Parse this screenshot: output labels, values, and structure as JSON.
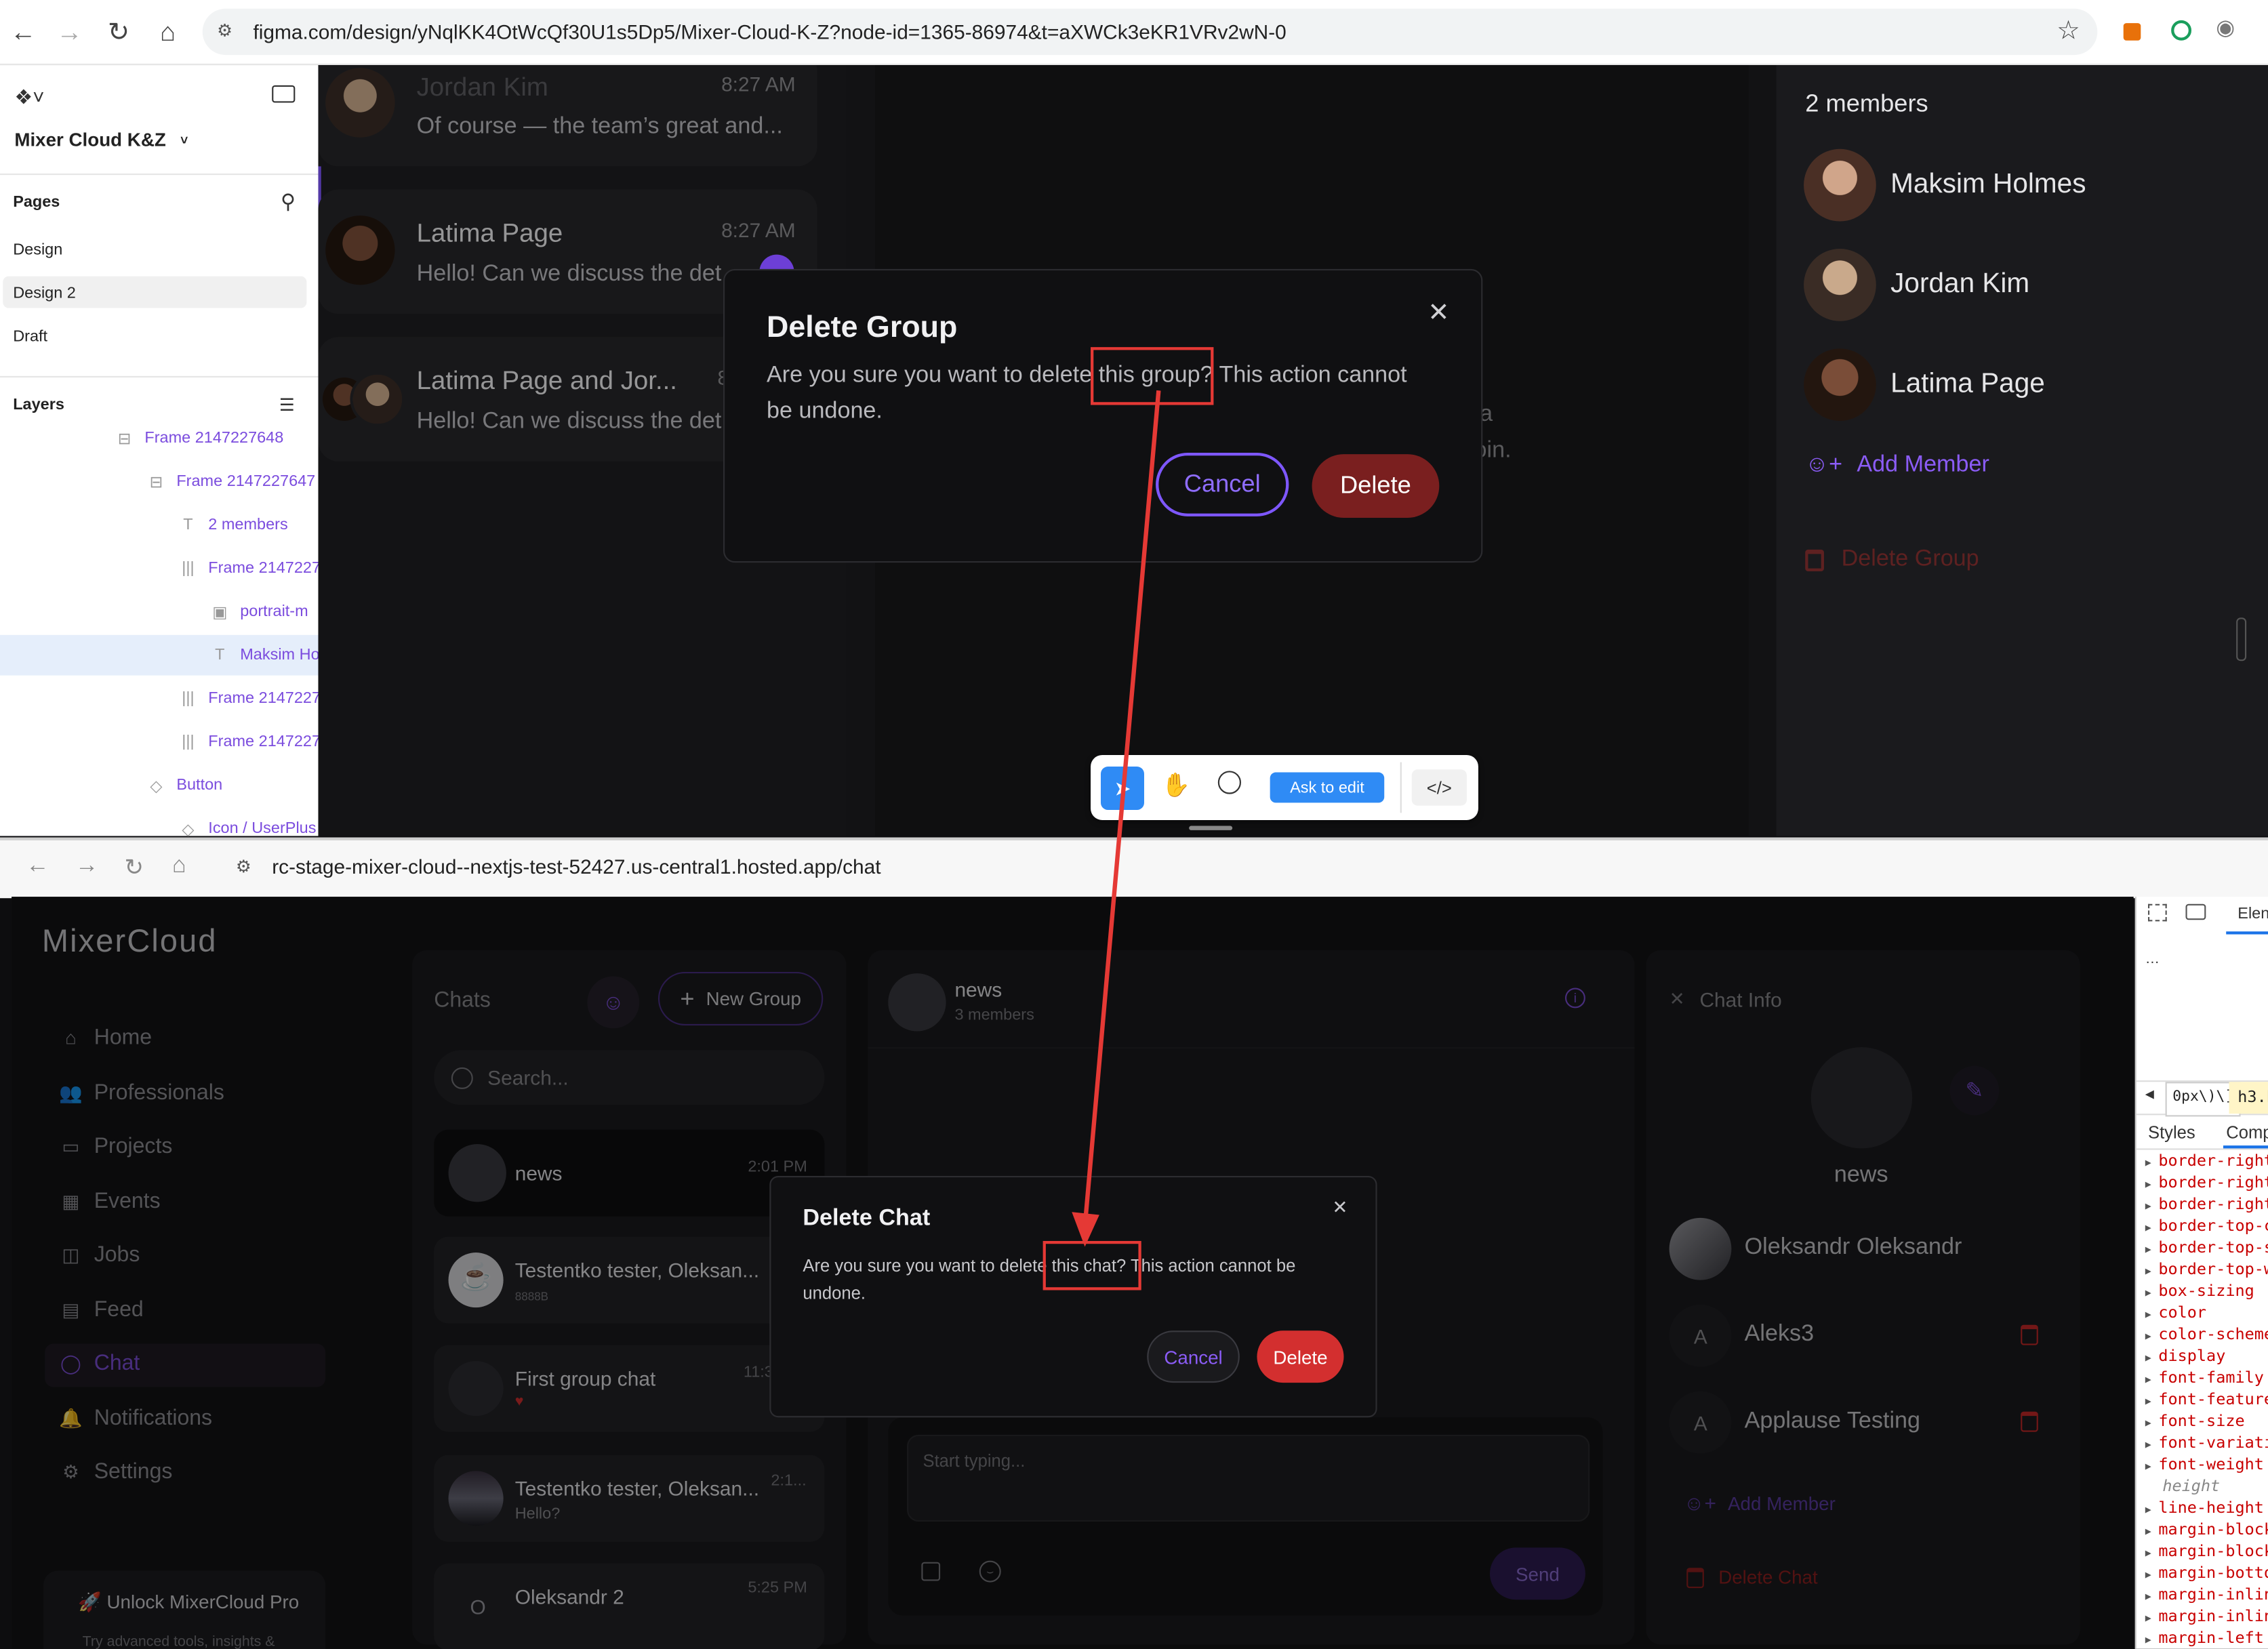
{
  "figma_browser": {
    "url": "figma.com/design/yNqlKK4OtWcQf30U1s5Dp5/Mixer-Cloud-K-Z?node-id=1365-86974&t=aXWCk3eKR1VRv2wN-0"
  },
  "figma_left": {
    "file_name": "Mixer Cloud K&Z",
    "pages_title": "Pages",
    "pages": [
      "Design",
      "Design 2",
      "Draft"
    ],
    "selected_page": "Design 2",
    "layers_title": "Layers",
    "layers": [
      {
        "label": "Frame 2147227648",
        "glyph": "⊟"
      },
      {
        "label": "Frame 2147227647",
        "glyph": "⊟"
      },
      {
        "label": "2 members",
        "glyph": "T"
      },
      {
        "label": "Frame 2147227",
        "glyph": "|||"
      },
      {
        "label": "portrait-m",
        "glyph": "▣"
      },
      {
        "label": "Maksim Ho",
        "glyph": "T"
      },
      {
        "label": "Frame 2147227",
        "glyph": "|||"
      },
      {
        "label": "Frame 2147227",
        "glyph": "|||"
      },
      {
        "label": "Button",
        "glyph": "◇"
      },
      {
        "label": "Icon / UserPlus",
        "glyph": "◇"
      }
    ]
  },
  "figma_canvas": {
    "chats": [
      {
        "name": "Jordan Kim",
        "time": "8:27 AM",
        "preview": "Of course — the team’s great and..."
      },
      {
        "name": "Latima Page",
        "time": "8:27 AM",
        "preview": "Hello! Can we discuss the det"
      },
      {
        "name": "Latima Page and Jor...",
        "time": "8",
        "preview": "Hello! Can we discuss the det"
      }
    ],
    "partial_text_1": "a",
    "partial_text_2": "oin.",
    "members_title": "2 members",
    "members": [
      "Maksim Holmes",
      "Jordan Kim",
      "Latima Page"
    ],
    "add_member": "Add Member",
    "delete_group": "Delete Group",
    "modal": {
      "title": "Delete Group",
      "body_1": "Are you sure you want to delete ",
      "body_highlight": "this group?",
      "body_2": " This action cannot be undone.",
      "cancel": "Cancel",
      "delete": "Delete"
    },
    "toolbar": {
      "ask_to_edit": "Ask to edit"
    }
  },
  "app_browser": {
    "url": "rc-stage-mixer-cloud--nextjs-test-52427.us-central1.hosted.app/chat"
  },
  "app": {
    "brand": "MixerCloud",
    "nav": [
      {
        "label": "Home",
        "icon": "⌂"
      },
      {
        "label": "Professionals",
        "icon": "👥"
      },
      {
        "label": "Projects",
        "icon": "▭"
      },
      {
        "label": "Events",
        "icon": "▦"
      },
      {
        "label": "Jobs",
        "icon": "◫"
      },
      {
        "label": "Feed",
        "icon": "▤"
      },
      {
        "label": "Chat",
        "icon": "◯"
      },
      {
        "label": "Notifications",
        "icon": "🔔"
      },
      {
        "label": "Settings",
        "icon": "⚙"
      }
    ],
    "active_nav": "Chat",
    "pro_banner": "🚀 Unlock MixerCloud Pro",
    "pro_sub": "Try advanced tools, insights &",
    "chats_title": "Chats",
    "new_group": "New Group",
    "search_placeholder": "Search...",
    "chat_list": [
      {
        "name": "news",
        "time": "2:01 PM",
        "preview": ""
      },
      {
        "name": "Testentko tester, Oleksan...",
        "time": "",
        "preview": "8888B"
      },
      {
        "name": "First group chat",
        "time": "11:3",
        "preview": "♥"
      },
      {
        "name": "Testentko tester, Oleksan...",
        "time": "2:1...",
        "preview": "Hello?"
      },
      {
        "name": "Oleksandr 2",
        "time": "5:25 PM",
        "preview": ""
      }
    ],
    "conversation": {
      "name": "news",
      "members": "3 members",
      "input_placeholder": "Start typing...",
      "send": "Send"
    },
    "info": {
      "title": "Chat Info",
      "group_name": "news",
      "members": [
        {
          "name": "Oleksandr Oleksandr",
          "initial": ""
        },
        {
          "name": "Aleks3",
          "initial": "A"
        },
        {
          "name": "Applause Testing",
          "initial": "A"
        }
      ],
      "add_member": "Add Member",
      "delete_chat": "Delete Chat"
    },
    "modal": {
      "title": "Delete Chat",
      "body_1": "Are you sure you want to delete ",
      "body_highlight": "this chat?",
      "body_2": " This action cannot be undone.",
      "cancel": "Cancel",
      "delete": "Delete"
    }
  },
  "devtools": {
    "tab": "Elen",
    "crumb_1": "0px\\)\\]",
    "crumb_2": "h3.b",
    "styles_tab": "Styles",
    "computed_tab": "Comp",
    "props": [
      "border-right",
      "border-right",
      "border-right",
      "border-top-c",
      "border-top-s",
      "border-top-w",
      "box-sizing",
      "color",
      "color-scheme",
      "display",
      "font-family",
      "font-feature",
      "font-size",
      "font-variati",
      "font-weight",
      "height",
      "line-height",
      "margin-block",
      "margin-block",
      "margin-botto",
      "margin-inlin",
      "margin-inlin",
      "margin-left"
    ]
  },
  "colors": {
    "annotation_red": "#e53935",
    "figma_delete": "#7a1f1f",
    "figma_purple": "#7e57ff",
    "app_delete": "#d32f2f",
    "app_purple": "#8e5cf7"
  }
}
